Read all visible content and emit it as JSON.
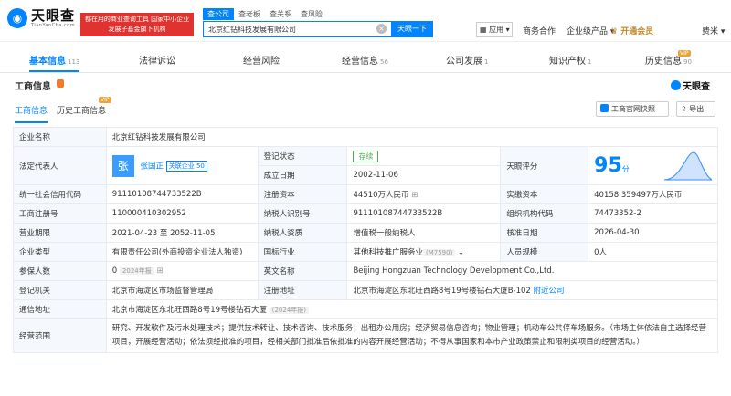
{
  "header": {
    "logo_cn": "天眼查",
    "logo_en": "TianYanCha.com",
    "slogan": "都在用的商业查询工具 国家中小企业发展子基金旗下机构",
    "search_tabs": [
      "查公司",
      "查老板",
      "查关系",
      "查风险"
    ],
    "search_value": "北京红钻科技发展有限公司",
    "search_button": "天眼一下",
    "app_label": "应用",
    "nav": [
      "商务合作",
      "企业级产品"
    ],
    "vip_label": "开通会员",
    "user": "费米"
  },
  "tabs": [
    {
      "label": "基本信息",
      "count": "113"
    },
    {
      "label": "法律诉讼",
      "count": ""
    },
    {
      "label": "经营风险",
      "count": ""
    },
    {
      "label": "经营信息",
      "count": "56"
    },
    {
      "label": "公司发展",
      "count": "1"
    },
    {
      "label": "知识产权",
      "count": "1"
    },
    {
      "label": "历史信息",
      "count": "90"
    }
  ],
  "vip_tag": "VIP",
  "section": {
    "title": "工商信息",
    "logo": "天眼查",
    "sub_tabs": [
      "工商信息",
      "历史工商信息"
    ],
    "quick_btn": "工商官网快照",
    "export_btn": "导出"
  },
  "table": {
    "company_name_label": "企业名称",
    "company_name": "北京红钻科技发展有限公司",
    "legal_rep_label": "法定代表人",
    "legal_rep_avatar": "张",
    "legal_rep": "张国正",
    "related_label": "关联企业 50",
    "reg_status_label": "登记状态",
    "reg_status": "存续",
    "est_date_label": "成立日期",
    "est_date": "2002-11-06",
    "score_label": "天眼评分",
    "score": "95",
    "score_unit": "分",
    "credit_code_label": "统一社会信用代码",
    "credit_code": "911101087447335 22B",
    "reg_capital_label": "注册资本",
    "reg_capital": "44510万人民币",
    "paid_capital_label": "实缴资本",
    "paid_capital": "40158.359497万人民币",
    "reg_no_label": "工商注册号",
    "reg_no": "110000410302952",
    "taxpayer_id_label": "纳税人识别号",
    "taxpayer_id": "91110108744733522B",
    "org_code_label": "组织机构代码",
    "org_code": "74473352-2",
    "term_label": "营业期限",
    "term": "2021-04-23 至 2052-11-05",
    "taxpayer_type_label": "纳税人资质",
    "taxpayer_type": "增值税一般纳税人",
    "approval_date_label": "核准日期",
    "approval_date": "2026-04-30",
    "company_type_label": "企业类型",
    "company_type": "有限责任公司(外商投资企业法人独资)",
    "industry_label": "国标行业",
    "industry": "其他科技推广服务业",
    "industry_code": "(M7590)",
    "staff_size_label": "人员规模",
    "staff_size": "0人",
    "insured_label": "参保人数",
    "insured": "0",
    "insured_year": "2024年报",
    "en_name_label": "英文名称",
    "en_name": "Beijing Hongzuan Technology Development Co.,Ltd.",
    "reg_authority_label": "登记机关",
    "reg_authority": "北京市海淀区市场监督管理局",
    "reg_address_label": "注册地址",
    "reg_address": "北京市海淀区东北旺西路8号19号楼钻石大厦B-102",
    "nearby": "附近公司",
    "mail_address_label": "通信地址",
    "mail_address": "北京市海淀区东北旺西路8号19号楼钻石大厦",
    "mail_year": "(2024年报)",
    "scope_label": "经营范围",
    "scope": "研究、开发软件及污水处理技术；提供技术转让、技术咨询、技术服务；出租办公用房；经济贸易信息咨询；物业管理；机动车公共停车场服务。（市场主体依法自主选择经营项目，开展经营活动；依法须经批准的项目，经相关部门批准后依批准的内容开展经营活动；不得从事国家和本市产业政策禁止和限制类项目的经营活动。）"
  }
}
